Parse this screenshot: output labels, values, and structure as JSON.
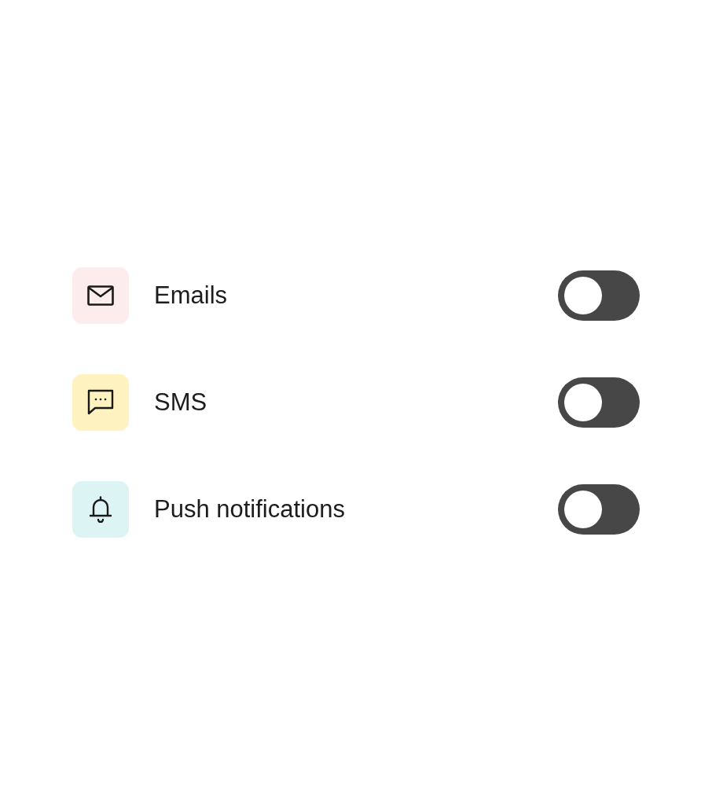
{
  "items": [
    {
      "kind": "mail",
      "label": "Emails",
      "color": "#fdecee",
      "on": false
    },
    {
      "kind": "chat",
      "label": "SMS",
      "color": "#fef3c0",
      "on": false
    },
    {
      "kind": "bell",
      "label": "Push notifications",
      "color": "#dcf5f4",
      "on": false
    }
  ]
}
